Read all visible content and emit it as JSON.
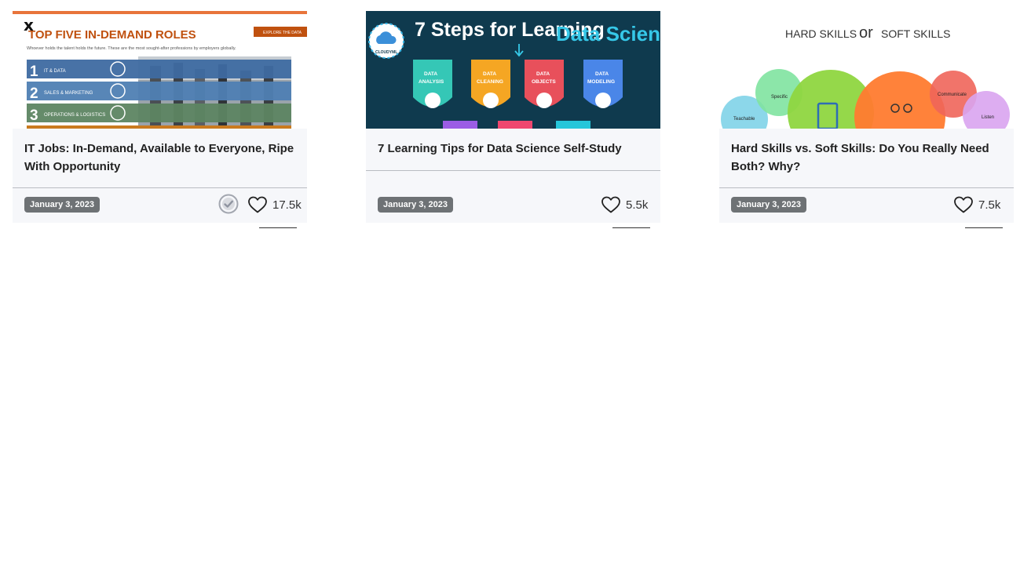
{
  "close_label": "x",
  "cards": [
    {
      "title": "IT Jobs: In-Demand, Available to Everyone, Ripe With Opportunity",
      "date": "January 3, 2023",
      "likes": "17.5k",
      "thumb": {
        "heading": "TOP FIVE IN-DEMAND ROLES",
        "button": "EXPLORE THE DATA",
        "subtitle": "Whoever holds the talent holds the future. These are the most sought-after professions by employers globally.",
        "roles": [
          {
            "num": "1",
            "label": "IT & DATA"
          },
          {
            "num": "2",
            "label": "SALES & MARKETING"
          },
          {
            "num": "3",
            "label": "OPERATIONS & LOGISTICS"
          }
        ]
      }
    },
    {
      "title": "7 Learning Tips for Data Science Self-Study",
      "date": "January 3, 2023",
      "likes": "5.5k",
      "thumb": {
        "heading_a": "7 Steps for Learning",
        "heading_b": "Data Science",
        "logo": "CLOUDYML",
        "steps": [
          {
            "l1": "DATA",
            "l2": "ANALYSIS",
            "color": "#35c7b6"
          },
          {
            "l1": "DATA",
            "l2": "CLEANING",
            "color": "#f5a623"
          },
          {
            "l1": "DATA",
            "l2": "OBJECTS",
            "color": "#e8505b"
          },
          {
            "l1": "DATA",
            "l2": "MODELING",
            "color": "#4a86e8"
          }
        ]
      }
    },
    {
      "title": "Hard Skills vs. Soft Skills: Do You Really Need Both? Why?",
      "date": "January 3, 2023",
      "likes": "7.5k",
      "thumb": {
        "left": "HARD SKILLS",
        "mid": "or",
        "right": "SOFT SKILLS",
        "bubbles": [
          "Teachable",
          "Specific",
          "Communicate",
          "Listen"
        ]
      }
    }
  ]
}
